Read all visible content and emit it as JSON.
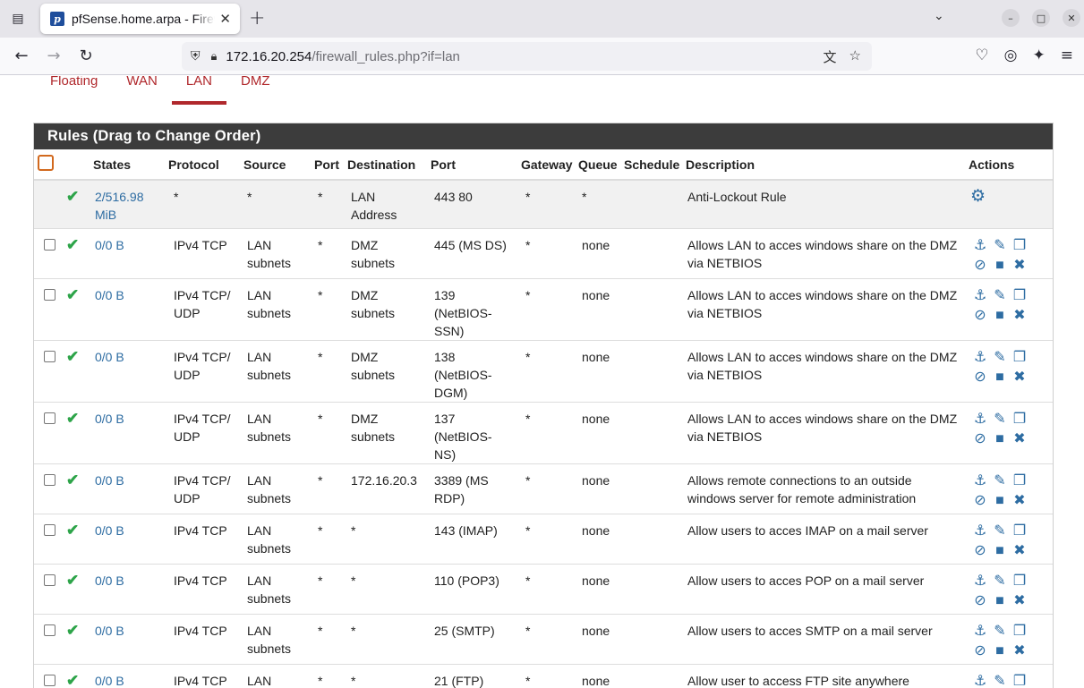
{
  "browser": {
    "tab_title": "pfSense.home.arpa - Firewall: Rules: LAN",
    "url_host": "172.16.20.254",
    "url_path": "/firewall_rules.php?if=lan"
  },
  "subtabs": [
    "Floating",
    "WAN",
    "LAN",
    "DMZ"
  ],
  "panel": {
    "title": "Rules (Drag to Change Order)"
  },
  "columns": [
    "",
    "",
    "States",
    "Protocol",
    "Source",
    "Port",
    "Destination",
    "Port",
    "Gateway",
    "Queue",
    "Schedule",
    "Description",
    "Actions"
  ],
  "rules": [
    {
      "states": "2/516.98 MiB",
      "protocol": "*",
      "source": "*",
      "sport": "*",
      "dest": "LAN Address",
      "dport": "443 80",
      "gateway": "*",
      "queue": "*",
      "schedule": "",
      "desc": "Anti-Lockout Rule"
    },
    {
      "states": "0/0 B",
      "protocol": "IPv4 TCP",
      "source": "LAN subnets",
      "sport": "*",
      "dest": "DMZ subnets",
      "dport": "445 (MS DS)",
      "gateway": "*",
      "queue": "none",
      "schedule": "",
      "desc": "Allows LAN to acces windows share on the DMZ via NETBIOS"
    },
    {
      "states": "0/0 B",
      "protocol": "IPv4 TCP/ UDP",
      "source": "LAN subnets",
      "sport": "*",
      "dest": "DMZ subnets",
      "dport": "139 (NetBIOS-SSN)",
      "gateway": "*",
      "queue": "none",
      "schedule": "",
      "desc": "Allows LAN to acces windows share on the DMZ via NETBIOS"
    },
    {
      "states": "0/0 B",
      "protocol": "IPv4 TCP/ UDP",
      "source": "LAN subnets",
      "sport": "*",
      "dest": "DMZ subnets",
      "dport": "138 (NetBIOS-DGM)",
      "gateway": "*",
      "queue": "none",
      "schedule": "",
      "desc": "Allows LAN to acces windows share on the DMZ via NETBIOS"
    },
    {
      "states": "0/0 B",
      "protocol": "IPv4 TCP/ UDP",
      "source": "LAN subnets",
      "sport": "*",
      "dest": "DMZ subnets",
      "dport": "137 (NetBIOS-NS)",
      "gateway": "*",
      "queue": "none",
      "schedule": "",
      "desc": "Allows LAN to acces windows share on the DMZ via NETBIOS"
    },
    {
      "states": "0/0 B",
      "protocol": "IPv4 TCP/ UDP",
      "source": "LAN subnets",
      "sport": "*",
      "dest": "172.16.20.3",
      "dport": "3389 (MS RDP)",
      "gateway": "*",
      "queue": "none",
      "schedule": "",
      "desc": "Allows remote connections to an outside windows server for remote administration"
    },
    {
      "states": "0/0 B",
      "protocol": "IPv4 TCP",
      "source": "LAN subnets",
      "sport": "*",
      "dest": "*",
      "dport": "143 (IMAP)",
      "gateway": "*",
      "queue": "none",
      "schedule": "",
      "desc": "Allow users to acces IMAP on a mail server"
    },
    {
      "states": "0/0 B",
      "protocol": "IPv4 TCP",
      "source": "LAN subnets",
      "sport": "*",
      "dest": "*",
      "dport": "110 (POP3)",
      "gateway": "*",
      "queue": "none",
      "schedule": "",
      "desc": "Allow users to acces POP on a mail server"
    },
    {
      "states": "0/0 B",
      "protocol": "IPv4 TCP",
      "source": "LAN subnets",
      "sport": "*",
      "dest": "*",
      "dport": "25 (SMTP)",
      "gateway": "*",
      "queue": "none",
      "schedule": "",
      "desc": "Allow users to acces SMTP on a mail server"
    },
    {
      "states": "0/0 B",
      "protocol": "IPv4 TCP",
      "source": "LAN subnets",
      "sport": "*",
      "dest": "*",
      "dport": "21 (FTP)",
      "gateway": "*",
      "queue": "none",
      "schedule": "",
      "desc": "Allow user to access FTP site anywhere"
    }
  ]
}
